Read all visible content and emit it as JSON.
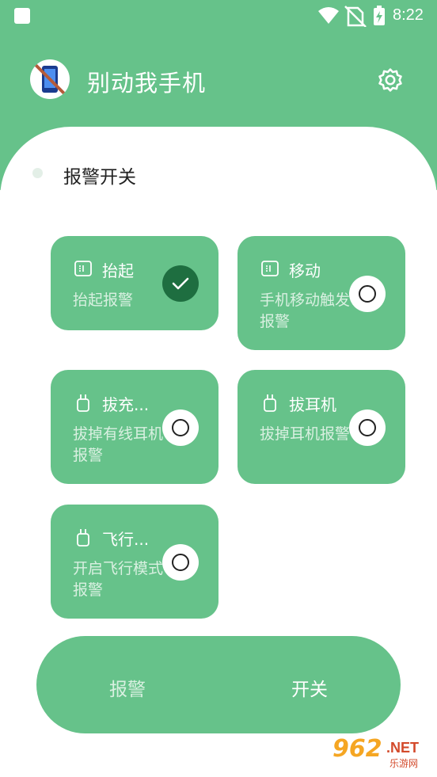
{
  "status_bar": {
    "time": "8:22"
  },
  "header": {
    "title": "别动我手机"
  },
  "section": {
    "title": "报警开关"
  },
  "cards": [
    {
      "title": "抬起",
      "desc": "抬起报警",
      "icon": "list-icon",
      "selected": true
    },
    {
      "title": "移动",
      "desc": "手机移动触发报警",
      "icon": "list-icon",
      "selected": false
    },
    {
      "title": "拔充...",
      "desc": "拔掉有线耳机报警",
      "icon": "plug-icon",
      "selected": false
    },
    {
      "title": "拔耳机",
      "desc": "拔掉耳机报警",
      "icon": "plug-icon",
      "selected": false
    },
    {
      "title": "飞行...",
      "desc": "开启飞行模式报警",
      "icon": "plug-icon",
      "selected": false
    }
  ],
  "bottom_toggle": {
    "left_label": "报警",
    "right_label": "开关"
  },
  "watermark": {
    "number": "962",
    "suffix": ".NET",
    "text": "乐游网"
  },
  "colors": {
    "primary": "#66c28a",
    "selected": "#1e6e40"
  }
}
